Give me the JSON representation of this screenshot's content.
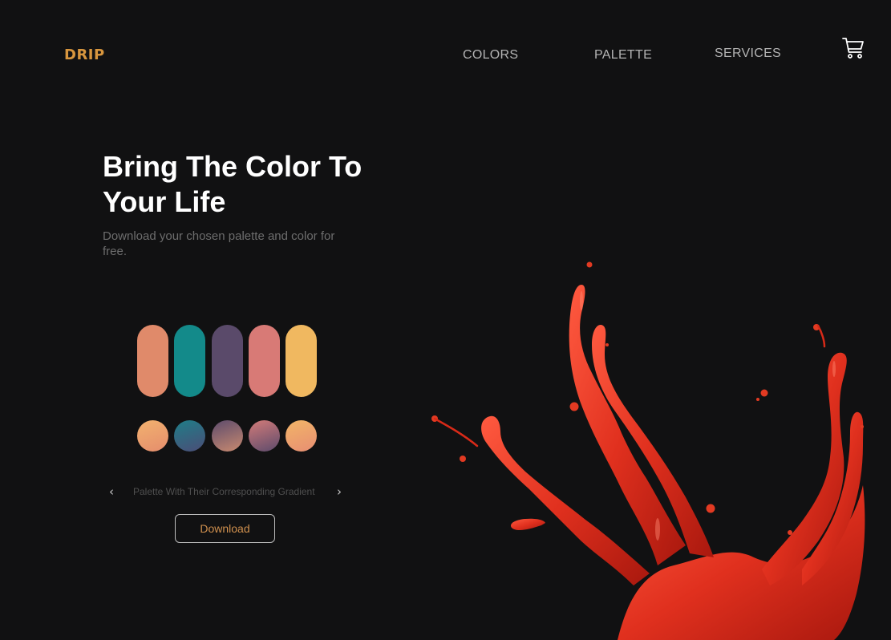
{
  "header": {
    "logo": "DRIP",
    "nav": [
      "COLORS",
      "PALETTE",
      "SERVICES"
    ],
    "cart_icon": "cart-icon"
  },
  "hero": {
    "title_line1": "Bring The Color To",
    "title_line2": "Your Life",
    "subtitle": "Download your chosen palette and color for free."
  },
  "palette": {
    "colors": [
      "#e08a6a",
      "#138a8a",
      "#5a4a6a",
      "#d87a76",
      "#f0b860"
    ],
    "gradients": [
      [
        "#f2b26e",
        "#e58d6d"
      ],
      [
        "#1f7e88",
        "#4b4d77"
      ],
      [
        "#5d4b6c",
        "#c98a70"
      ],
      [
        "#d37b79",
        "#5d4b6c"
      ],
      [
        "#f2b567",
        "#e78e73"
      ]
    ],
    "caption": "Palette With Their Corresponding Gradient",
    "prev_icon": "chevron-left-icon",
    "next_icon": "chevron-right-icon",
    "download_label": "Download"
  },
  "decor": {
    "splash_color": "#e0301e"
  }
}
